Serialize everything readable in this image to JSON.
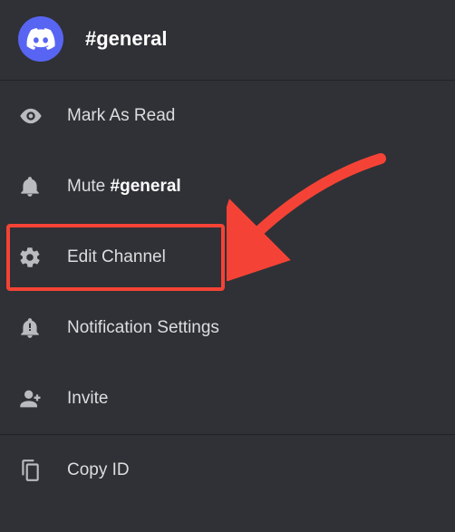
{
  "header": {
    "channel_title": "#general"
  },
  "menu": {
    "mark_read": "Mark As Read",
    "mute_prefix": "Mute ",
    "mute_channel": "#general",
    "edit_channel": "Edit Channel",
    "notification_settings": "Notification Settings",
    "invite": "Invite",
    "copy_id": "Copy ID"
  },
  "colors": {
    "accent": "#5865f2",
    "highlight": "#f44336"
  }
}
